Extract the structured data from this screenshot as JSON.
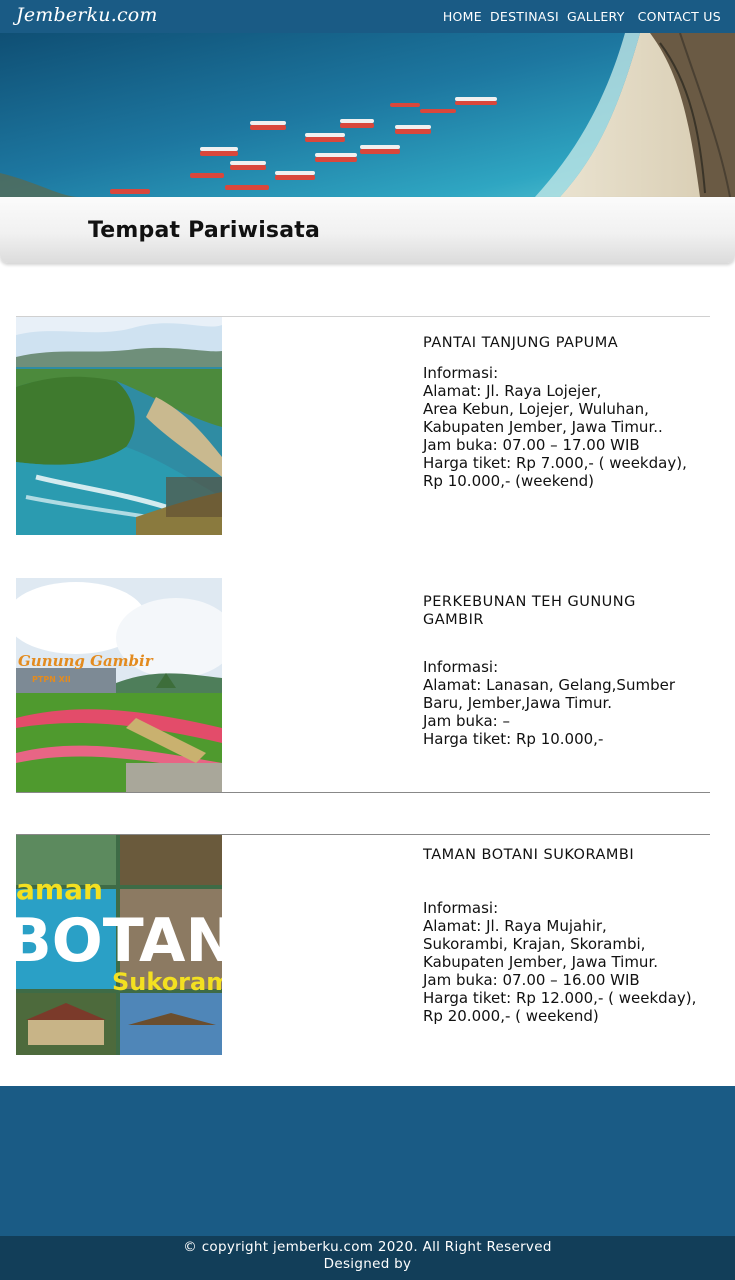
{
  "site": {
    "logo": "Jemberku.com"
  },
  "nav": {
    "items": [
      {
        "label": "HOME"
      },
      {
        "label": "DESTINASI"
      },
      {
        "label": "GALLERY"
      },
      {
        "label": "CONTACT US"
      }
    ]
  },
  "hero": {
    "image_icon": "beach-boats-photo"
  },
  "page": {
    "title": "Tempat Pariwisata"
  },
  "destinations": [
    {
      "title_lines": [
        "PANTAI TANJUNG PAPUMA"
      ],
      "info_lines": [
        "Informasi:",
        "Alamat: Jl. Raya Lojejer,",
        "Area Kebun, Lojejer, Wuluhan,",
        "Kabupaten Jember, Jawa Timur..",
        "Jam buka: 07.00 – 17.00 WIB",
        "Harga tiket: Rp 7.000,- ( weekday),",
        "Rp 10.000,- (weekend)"
      ]
    },
    {
      "title_lines": [
        "PERKEBUNAN TEH GUNUNG",
        "GAMBIR"
      ],
      "info_lines": [
        "Informasi:",
        "Alamat: Lanasan, Gelang,Sumber",
        "Baru, Jember,Jawa Timur.",
        "Jam buka: –",
        "Harga tiket: Rp 10.000,-"
      ],
      "image_text": [
        "Gunung Gambir",
        "PTPN XII"
      ]
    },
    {
      "title_lines": [
        "TAMAN BOTANI SUKORAMBI"
      ],
      "info_lines": [
        "Informasi:",
        "Alamat: Jl. Raya Mujahir,",
        "Sukorambi, Krajan, Skorambi,",
        "Kabupaten Jember, Jawa Timur.",
        "Jam buka: 07.00 – 16.00 WIB",
        "Harga tiket: Rp 12.000,- ( weekday),",
        "Rp 20.000,- ( weekend)"
      ],
      "image_text": [
        "aman",
        "BOTAN",
        "Sukoram"
      ]
    }
  ],
  "footer": {
    "copyright": "© copyright jemberku.com 2020. All Right Reserved",
    "designed_by": "Designed by"
  },
  "colors": {
    "header": "#1a5b85",
    "footer_bottom": "#123e59",
    "text": "#111111"
  }
}
